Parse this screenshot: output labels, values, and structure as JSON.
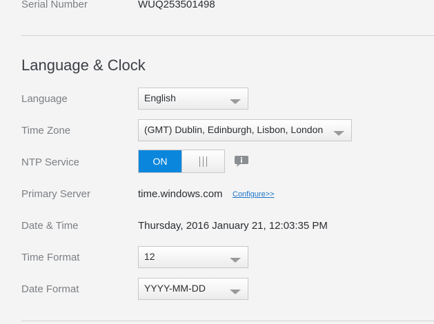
{
  "serial": {
    "label": "Serial Number",
    "value": "WUQ253501498"
  },
  "section_title": "Language & Clock",
  "language": {
    "label": "Language",
    "selected": "English"
  },
  "time_zone": {
    "label": "Time Zone",
    "selected": "(GMT) Dublin, Edinburgh, Lisbon, London"
  },
  "ntp": {
    "label": "NTP Service",
    "state": "ON"
  },
  "primary_server": {
    "label": "Primary Server",
    "value": "time.windows.com",
    "configure_link": "Configure>>"
  },
  "date_time": {
    "label": "Date & Time",
    "value": "Thursday, 2016 January 21, 12:03:35 PM"
  },
  "time_format": {
    "label": "Time Format",
    "selected": "12"
  },
  "date_format": {
    "label": "Date Format",
    "selected": "YYYY-MM-DD"
  },
  "colors": {
    "accent": "#0b86dd",
    "label": "#7b7f84",
    "text": "#2a2d31"
  },
  "icons": {
    "info": "info-speech-bubble-icon",
    "dropdown": "chevron-down-icon"
  }
}
